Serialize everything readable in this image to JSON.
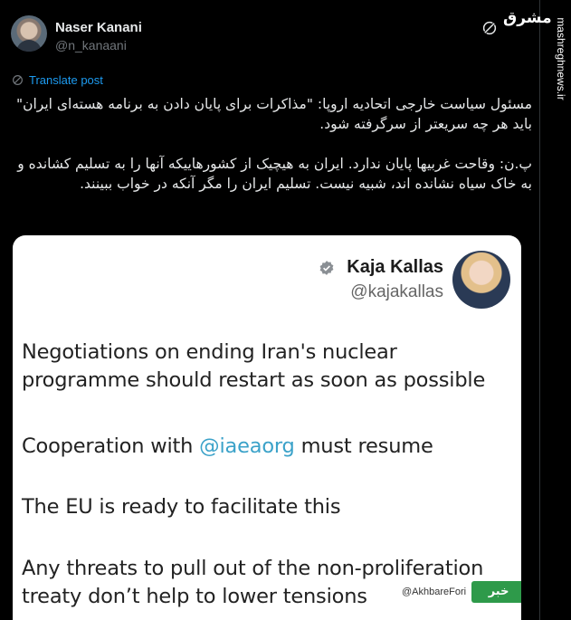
{
  "author": {
    "name": "Naser Kanani",
    "handle": "@n_kanaani"
  },
  "site": {
    "logo_text": "مشرق",
    "url": "mashreghnews.ir"
  },
  "translate": {
    "label": "Translate post"
  },
  "tweet": {
    "paragraph1": "مسئول سیاست خارجی اتحادیه اروپا: \"مذاکرات برای پایان دادن به برنامه هسته‌ای ایران\" باید هر چه سریعتر از سرگرفته شود.",
    "paragraph2": "پ.ن: وقاحت غربیها پایان ندارد. ایران به هیچیک از کشورهاییکه آنها را به تسلیم کشانده و به خاک سیاه نشانده اند، شبیه نیست. تسلیم ایران را مگر آنکه در خواب ببینند."
  },
  "quoted_card": {
    "name": "Kaja Kallas",
    "handle": "@kajakallas",
    "line1": "Negotiations on ending Iran's nuclear programme should restart as soon as possible",
    "line2_prefix": "Cooperation with ",
    "line2_mention": "@iaeaorg",
    "line2_suffix": " must resume",
    "line3": "The EU is ready to facilitate this",
    "line4": "Any threats to pull out of the non-proliferation treaty don’t help to lower tensions"
  },
  "watermark": {
    "handle": "@AkhbareFori",
    "logo_text": "خبر فوری"
  },
  "colors": {
    "background": "#000000",
    "link": "#1d9bf0",
    "mention": "#3ba2c9",
    "card": "#ffffff"
  },
  "icons": {
    "grok": "grok-icon",
    "translate": "translate-icon",
    "verified": "verified-badge-icon"
  }
}
